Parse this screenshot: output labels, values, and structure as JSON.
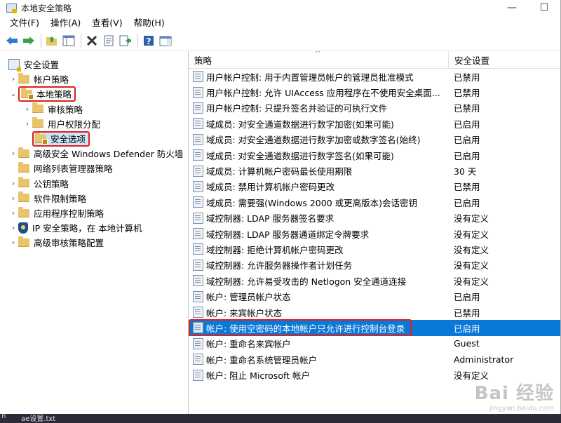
{
  "window": {
    "title": "本地安全策略"
  },
  "menu": [
    "文件(F)",
    "操作(A)",
    "查看(V)",
    "帮助(H)"
  ],
  "tree": [
    {
      "label": "安全设置",
      "level": 0,
      "expander": "",
      "icon": "root"
    },
    {
      "label": "帐户策略",
      "level": 1,
      "expander": "›",
      "icon": "folder"
    },
    {
      "label": "本地策略",
      "level": 1,
      "expander": "⌄",
      "icon": "folder-lock",
      "highlight": true
    },
    {
      "label": "审核策略",
      "level": 2,
      "expander": "›",
      "icon": "folder"
    },
    {
      "label": "用户权限分配",
      "level": 2,
      "expander": "›",
      "icon": "folder"
    },
    {
      "label": "安全选项",
      "level": 2,
      "expander": "",
      "icon": "folder-lock",
      "highlight": true,
      "selected": true
    },
    {
      "label": "高级安全 Windows Defender 防火墙",
      "level": 1,
      "expander": "›",
      "icon": "folder"
    },
    {
      "label": "网络列表管理器策略",
      "level": 1,
      "expander": "",
      "icon": "folder"
    },
    {
      "label": "公钥策略",
      "level": 1,
      "expander": "›",
      "icon": "folder"
    },
    {
      "label": "软件限制策略",
      "level": 1,
      "expander": "›",
      "icon": "folder"
    },
    {
      "label": "应用程序控制策略",
      "level": 1,
      "expander": "›",
      "icon": "folder"
    },
    {
      "label": "IP 安全策略，在 本地计算机",
      "level": 1,
      "expander": "›",
      "icon": "shield"
    },
    {
      "label": "高级审核策略配置",
      "level": 1,
      "expander": "›",
      "icon": "folder"
    }
  ],
  "list": {
    "headers": {
      "policy": "策略",
      "setting": "安全设置"
    },
    "rows": [
      {
        "policy": "用户帐户控制: 用于内置管理员帐户的管理员批准模式",
        "setting": "已禁用"
      },
      {
        "policy": "用户帐户控制: 允许 UIAccess 应用程序在不使用安全桌面...",
        "setting": "已禁用"
      },
      {
        "policy": "用户帐户控制: 只提升签名并验证的可执行文件",
        "setting": "已禁用"
      },
      {
        "policy": "域成员: 对安全通道数据进行数字加密(如果可能)",
        "setting": "已启用"
      },
      {
        "policy": "域成员: 对安全通道数据进行数字加密或数字签名(始终)",
        "setting": "已启用"
      },
      {
        "policy": "域成员: 对安全通道数据进行数字签名(如果可能)",
        "setting": "已启用"
      },
      {
        "policy": "域成员: 计算机帐户密码最长使用期限",
        "setting": "30 天"
      },
      {
        "policy": "域成员: 禁用计算机帐户密码更改",
        "setting": "已禁用"
      },
      {
        "policy": "域成员: 需要强(Windows 2000 或更高版本)会话密钥",
        "setting": "已启用"
      },
      {
        "policy": "域控制器: LDAP 服务器签名要求",
        "setting": "没有定义"
      },
      {
        "policy": "域控制器: LDAP 服务器通道绑定令牌要求",
        "setting": "没有定义"
      },
      {
        "policy": "域控制器: 拒绝计算机帐户密码更改",
        "setting": "没有定义"
      },
      {
        "policy": "域控制器: 允许服务器操作者计划任务",
        "setting": "没有定义"
      },
      {
        "policy": "域控制器: 允许易受攻击的 Netlogon 安全通道连接",
        "setting": "没有定义"
      },
      {
        "policy": "帐户: 管理员帐户状态",
        "setting": "已启用"
      },
      {
        "policy": "帐户: 来宾帐户状态",
        "setting": "已禁用"
      },
      {
        "policy": "帐户: 使用空密码的本地帐户只允许进行控制台登录",
        "setting": "已启用",
        "selected": true,
        "highlight": true
      },
      {
        "policy": "帐户: 重命名来宾帐户",
        "setting": "Guest"
      },
      {
        "policy": "帐户: 重命名系统管理员帐户",
        "setting": "Administrator"
      },
      {
        "policy": "帐户: 阻止 Microsoft 帐户",
        "setting": "没有定义"
      }
    ]
  },
  "taskbar": {
    "left": "n",
    "item": "ae设置.txt"
  },
  "watermark": {
    "main": "Bai 经验",
    "sub": "jingyan.baidu.com"
  },
  "colors": {
    "selection": "#0a78d7",
    "highlight_box": "#e0201b",
    "folder": "#e9c46a"
  }
}
